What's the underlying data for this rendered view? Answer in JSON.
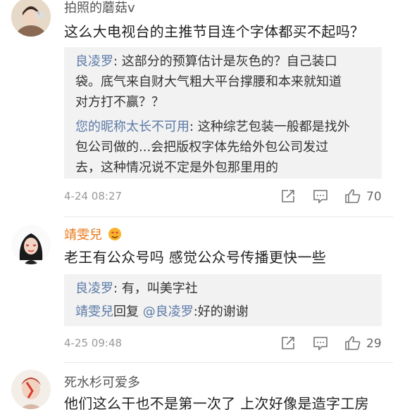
{
  "comments": [
    {
      "username": "拍照的蘑菇v",
      "text": "这么大电视台的主推节目连个字体都买不起吗？",
      "replies": [
        {
          "name": "良凌罗",
          "sep": ":",
          "text": " 这部分的预算估计是灰色的？自己装口",
          "cont": [
            "袋。底气来自财大气粗大平台撑腰和本来就知道",
            "对方打不赢？？"
          ]
        },
        {
          "name": "您的昵称太长不可用",
          "sep": ":",
          "text": " 这种综艺包装一般都是找外",
          "cont": [
            "包公司做的...会把版权字体先给外包公司发过",
            "去，这种情况说不定是外包那里用的"
          ]
        }
      ],
      "time": "4-24 08:27",
      "likes": "70"
    },
    {
      "username": "靖雯兒",
      "text": "老王有公众号吗 感觉公众号传播更快一些",
      "replies": [
        {
          "name": "良凌罗",
          "text": ": 有，叫美字社"
        },
        {
          "name": "靖雯兒",
          "mid": "回复 ",
          "name2": "@良凌罗",
          "text": ":好的谢谢"
        }
      ],
      "time": "4-25 09:48",
      "likes": "29"
    },
    {
      "username": "死水杉可爱多",
      "text": "他们这么干也不是第一次了 上次好像是造字工房"
    }
  ],
  "colors": {
    "link": "#5b7aa6",
    "meta": "#999999",
    "reply_bg": "#f2f2f2",
    "badge": "#e8791a"
  }
}
